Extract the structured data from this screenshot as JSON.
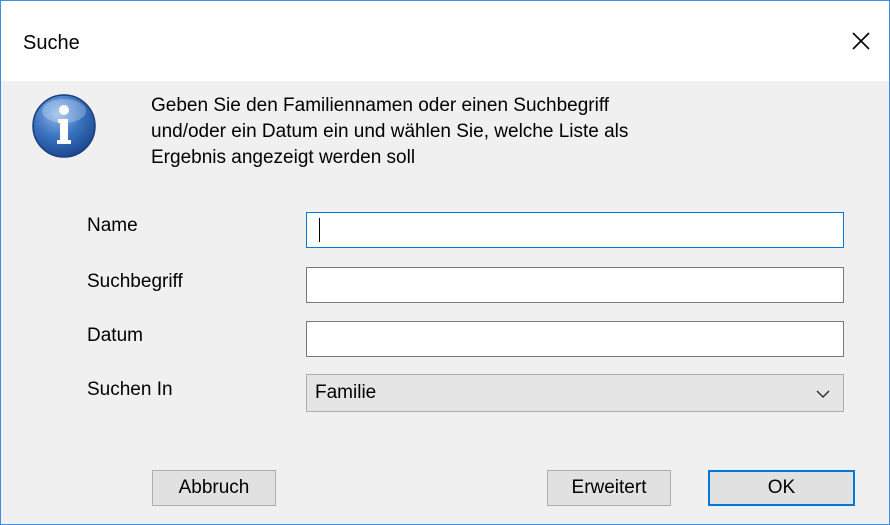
{
  "dialog": {
    "title": "Suche",
    "message_lines": [
      "Geben Sie den Familiennamen oder einen Suchbegriff",
      "und/oder ein Datum ein und wählen Sie, welche Liste als",
      "Ergebnis angezeigt werden soll"
    ]
  },
  "form": {
    "name_label": "Name",
    "name_value": "",
    "search_term_label": "Suchbegriff",
    "search_term_value": "",
    "date_label": "Datum",
    "date_value": "",
    "search_in_label": "Suchen In",
    "search_in_value": "Familie"
  },
  "buttons": {
    "cancel": "Abbruch",
    "advanced": "Erweitert",
    "ok": "OK"
  },
  "colors": {
    "accent": "#0078d7",
    "info_icon": "#2a5ea8"
  },
  "icons": {
    "info": "info-icon",
    "close": "close-icon",
    "chevron": "chevron-down-icon"
  }
}
